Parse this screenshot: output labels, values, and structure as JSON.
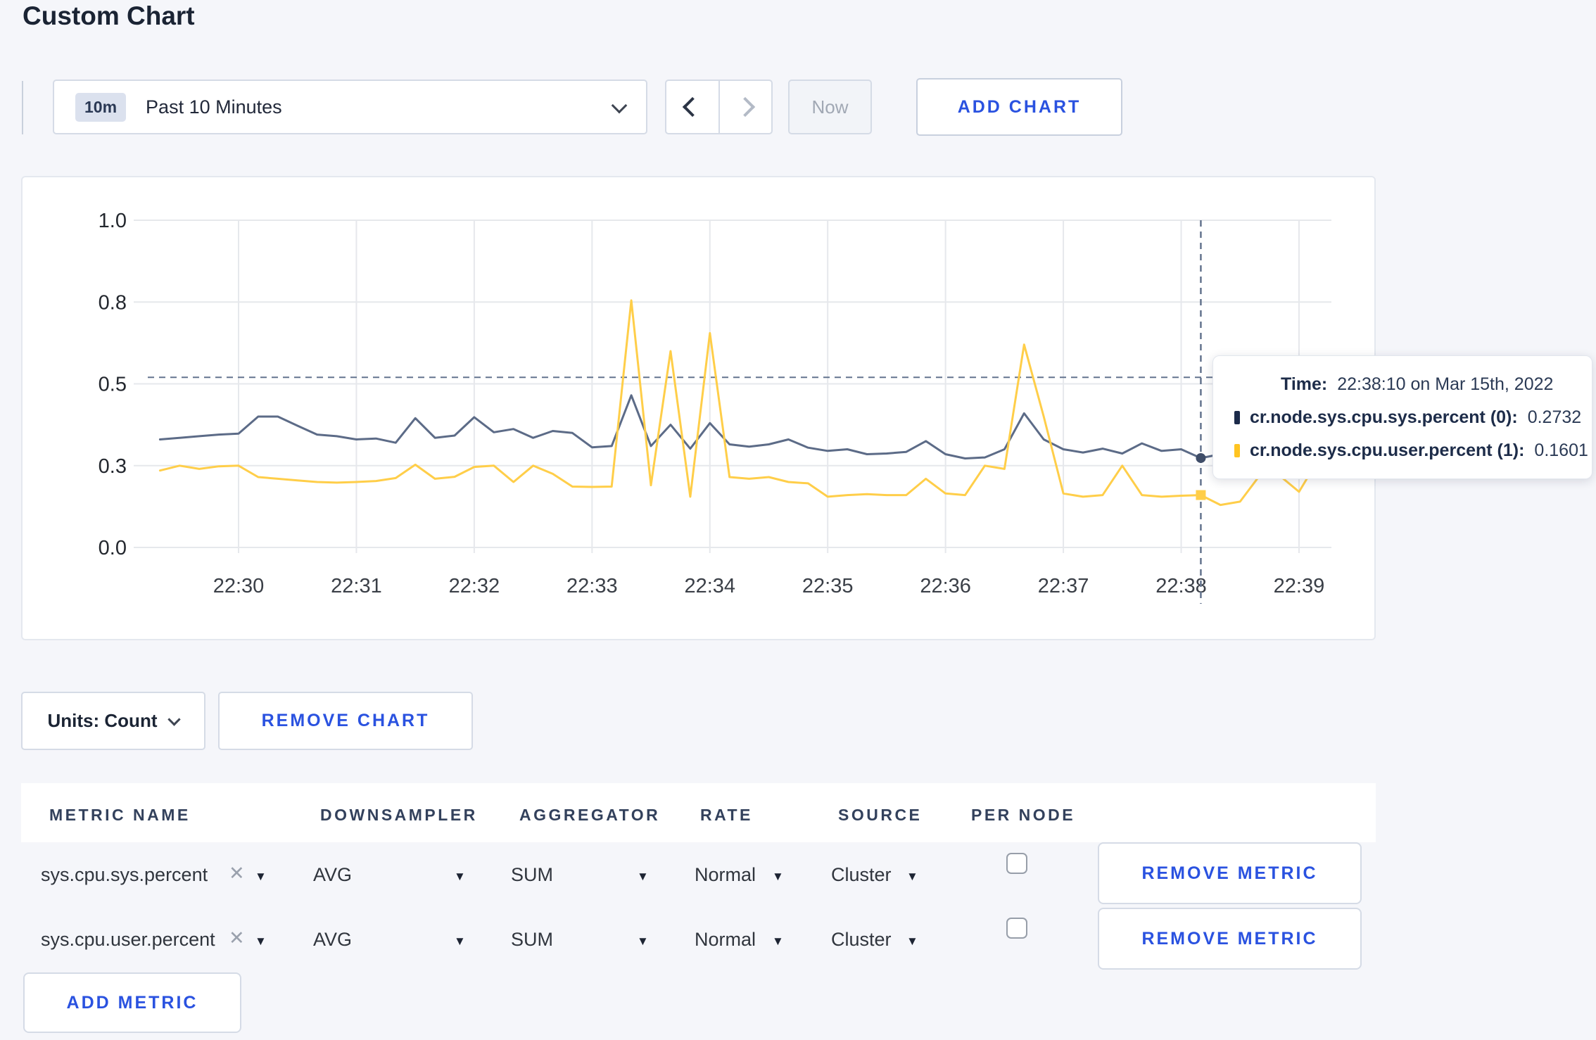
{
  "page": {
    "title": "Custom Chart"
  },
  "colors": {
    "action_blue": "#2a52e0",
    "series_sys": "#5c6b87",
    "series_user": "#ffce49",
    "gridline": "#e6e8ec",
    "dashed_guide": "#64748e",
    "tooltip_sys_square": "#1c2b4a",
    "tooltip_user_square": "#ffc421"
  },
  "toolbar": {
    "range_badge": "10m",
    "range_label": "Past 10 Minutes",
    "now_label": "Now",
    "add_chart_label": "ADD CHART",
    "prev_icon": "chevron-left",
    "next_icon": "chevron-right"
  },
  "chart_data": {
    "type": "line",
    "title": "",
    "xlabel": "",
    "ylabel": "",
    "ylim": [
      0,
      1
    ],
    "grid": true,
    "legend_position": "tooltip-only",
    "x_start": "22:29:20",
    "x_interval_seconds": 10,
    "x_tick_labels": [
      "22:30",
      "22:31",
      "22:32",
      "22:33",
      "22:34",
      "22:35",
      "22:36",
      "22:37",
      "22:38",
      "22:39"
    ],
    "y_tick_labels": [
      "0.0",
      "0.3",
      "0.5",
      "0.8",
      "1.0"
    ],
    "y_tick_values": [
      0,
      0.25,
      0.5,
      0.75,
      1.0
    ],
    "series": [
      {
        "name": "cr.node.sys.cpu.sys.percent (0)",
        "values": [
          0.33,
          0.335,
          0.34,
          0.345,
          0.348,
          0.4,
          0.4,
          0.372,
          0.345,
          0.34,
          0.33,
          0.333,
          0.32,
          0.395,
          0.335,
          0.342,
          0.398,
          0.352,
          0.362,
          0.335,
          0.356,
          0.35,
          0.306,
          0.31,
          0.465,
          0.31,
          0.375,
          0.302,
          0.38,
          0.315,
          0.308,
          0.315,
          0.33,
          0.305,
          0.295,
          0.3,
          0.285,
          0.287,
          0.292,
          0.325,
          0.285,
          0.272,
          0.275,
          0.3,
          0.41,
          0.33,
          0.3,
          0.29,
          0.302,
          0.287,
          0.318,
          0.295,
          0.3,
          0.2732,
          0.285,
          0.295,
          0.3,
          0.305,
          0.298,
          0.31
        ]
      },
      {
        "name": "cr.node.sys.cpu.user.percent (1)",
        "values": [
          0.235,
          0.25,
          0.24,
          0.248,
          0.25,
          0.215,
          0.21,
          0.205,
          0.2,
          0.198,
          0.2,
          0.203,
          0.212,
          0.253,
          0.21,
          0.216,
          0.246,
          0.25,
          0.2,
          0.25,
          0.225,
          0.186,
          0.185,
          0.186,
          0.755,
          0.19,
          0.6,
          0.155,
          0.655,
          0.215,
          0.21,
          0.215,
          0.2,
          0.196,
          0.155,
          0.16,
          0.163,
          0.16,
          0.16,
          0.21,
          0.165,
          0.16,
          0.25,
          0.24,
          0.62,
          0.4,
          0.165,
          0.155,
          0.16,
          0.25,
          0.16,
          0.155,
          0.158,
          0.1601,
          0.13,
          0.14,
          0.22,
          0.22,
          0.17,
          0.27
        ]
      }
    ],
    "crosshair": {
      "x_index": 53,
      "x_label": "22:38:10",
      "sys_value": 0.2732,
      "user_value": 0.1601,
      "guideline_value": 0.52
    }
  },
  "tooltip": {
    "time_label": "Time:",
    "time_value": "22:38:10 on Mar 15th, 2022",
    "rows": [
      {
        "name": "cr.node.sys.cpu.sys.percent (0):",
        "value": "0.2732"
      },
      {
        "name": "cr.node.sys.cpu.user.percent (1):",
        "value": "0.1601"
      }
    ]
  },
  "chart_controls": {
    "units_label": "Units: Count",
    "remove_chart_label": "REMOVE CHART"
  },
  "metrics_table": {
    "headers": [
      "METRIC NAME",
      "DOWNSAMPLER",
      "AGGREGATOR",
      "RATE",
      "SOURCE",
      "PER NODE"
    ],
    "remove_metric_label": "REMOVE METRIC",
    "add_metric_label": "ADD METRIC",
    "rows": [
      {
        "metric": "sys.cpu.sys.percent",
        "downsampler": "AVG",
        "aggregator": "SUM",
        "rate": "Normal",
        "source": "Cluster",
        "per_node_checked": false
      },
      {
        "metric": "sys.cpu.user.percent",
        "downsampler": "AVG",
        "aggregator": "SUM",
        "rate": "Normal",
        "source": "Cluster",
        "per_node_checked": false
      }
    ]
  }
}
